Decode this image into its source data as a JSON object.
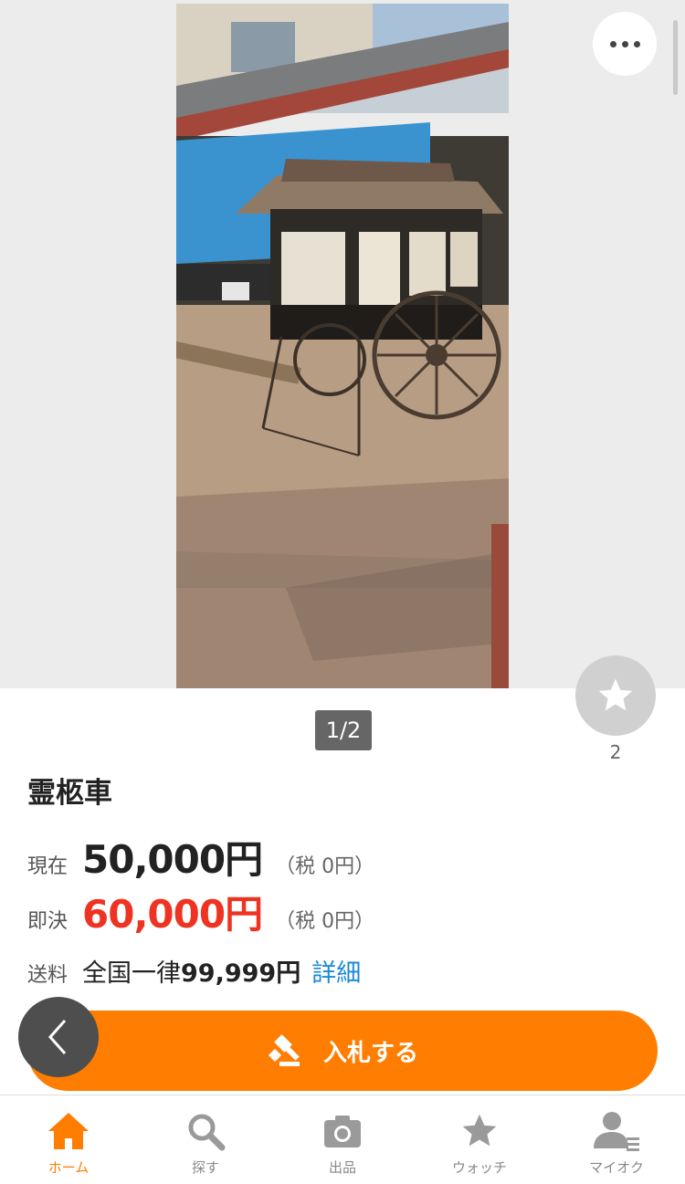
{
  "gallery": {
    "counter": "1/2",
    "more_icon": "more-dots-icon",
    "watch_icon": "star-icon",
    "watch_count": "2"
  },
  "item": {
    "title": "霊柩車"
  },
  "price": {
    "current_label": "現在",
    "current_value": "50,000円",
    "current_tax": "（税 0円）",
    "buynow_label": "即決",
    "buynow_value": "60,000円",
    "buynow_tax": "（税 0円）"
  },
  "shipping": {
    "label": "送料",
    "prefix": "全国一律",
    "amount": "99,999円",
    "detail_link": "詳細"
  },
  "actions": {
    "bid_label": "入札する",
    "bid_icon": "gavel-icon",
    "back_icon": "chevron-left-icon"
  },
  "tabbar": {
    "home": "ホーム",
    "search": "探す",
    "sell": "出品",
    "watch": "ウォッチ",
    "myauction": "マイオク"
  },
  "colors": {
    "accent": "#ff7d00",
    "buynow_price": "#ee3322",
    "link": "#1a8ad4"
  }
}
